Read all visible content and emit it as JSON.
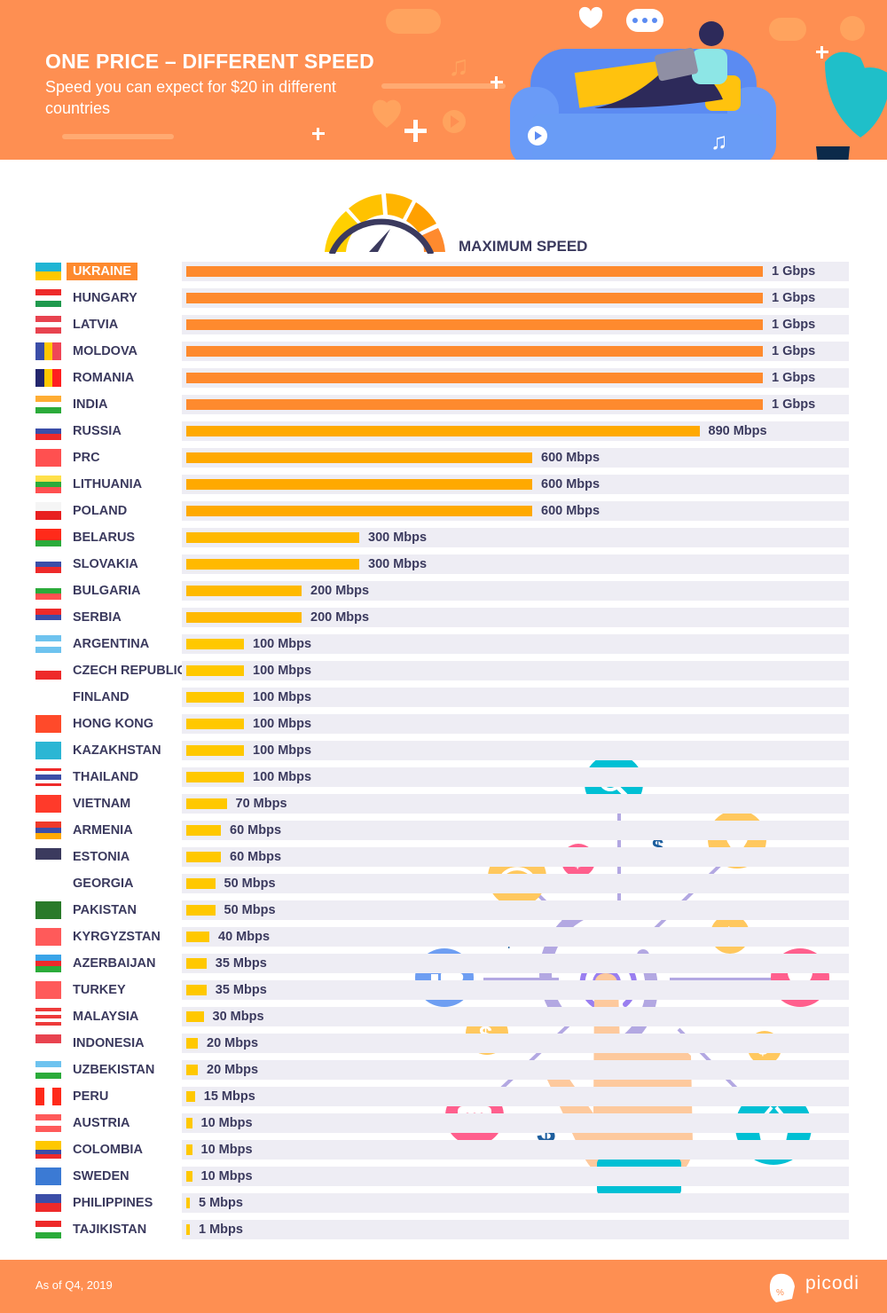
{
  "header": {
    "title": "ONE PRICE – DIFFERENT SPEED",
    "subtitle": "Speed you can expect for $20 in different countries"
  },
  "legend_label": "MAXIMUM SPEED",
  "footer": {
    "note": "As of Q4, 2019",
    "brand": "picodi"
  },
  "colors": {
    "header_bg": "#fe8f52",
    "bar_orange": "#fe8a2e",
    "bar_amber": "#ffa900",
    "bar_gold": "#ffb900",
    "bar_yellow": "#ffc800",
    "text_dark": "#3b3a5e",
    "track": "#eeedf4"
  },
  "chart_data": {
    "type": "bar",
    "orientation": "horizontal",
    "title": "ONE PRICE – DIFFERENT SPEED",
    "subtitle": "Speed you can expect for $20 in different countries",
    "series_label": "MAXIMUM SPEED",
    "unit": "Mbps",
    "highlighted": "UKRAINE",
    "categories": [
      "UKRAINE",
      "HUNGARY",
      "LATVIA",
      "MOLDOVA",
      "ROMANIA",
      "INDIA",
      "RUSSIA",
      "PRC",
      "LITHUANIA",
      "POLAND",
      "BELARUS",
      "SLOVAKIA",
      "BULGARIA",
      "SERBIA",
      "ARGENTINA",
      "CZECH REPUBLIC",
      "FINLAND",
      "HONG KONG",
      "KAZAKHSTAN",
      "THAILAND",
      "VIETNAM",
      "ARMENIA",
      "ESTONIA",
      "GEORGIA",
      "PAKISTAN",
      "KYRGYZSTAN",
      "AZERBAIJAN",
      "TURKEY",
      "MALAYSIA",
      "INDONESIA",
      "UZBEKISTAN",
      "PERU",
      "AUSTRIA",
      "COLOMBIA",
      "SWEDEN",
      "PHILIPPINES",
      "TAJIKISTAN"
    ],
    "values": [
      1000,
      1000,
      1000,
      1000,
      1000,
      1000,
      890,
      600,
      600,
      600,
      300,
      300,
      200,
      200,
      100,
      100,
      100,
      100,
      100,
      100,
      70,
      60,
      60,
      50,
      50,
      40,
      35,
      35,
      30,
      20,
      20,
      15,
      10,
      10,
      10,
      5,
      1
    ],
    "value_labels": [
      "1 Gbps",
      "1 Gbps",
      "1 Gbps",
      "1 Gbps",
      "1 Gbps",
      "1 Gbps",
      "890 Mbps",
      "600 Mbps",
      "600 Mbps",
      "600 Mbps",
      "300 Mbps",
      "300 Mbps",
      "200 Mbps",
      "200 Mbps",
      "100 Mbps",
      "100 Mbps",
      "100 Mbps",
      "100 Mbps",
      "100 Mbps",
      "100 Mbps",
      "70 Mbps",
      "60 Mbps",
      "60 Mbps",
      "50 Mbps",
      "50 Mbps",
      "40 Mbps",
      "35 Mbps",
      "35 Mbps",
      "30 Mbps",
      "20 Mbps",
      "20 Mbps",
      "15 Mbps",
      "10 Mbps",
      "10 Mbps",
      "10 Mbps",
      "5 Mbps",
      "1 Mbps"
    ],
    "xlim": [
      0,
      1000
    ],
    "grid": false,
    "legend": "top-center",
    "xlabel": "",
    "ylabel": ""
  },
  "flags": [
    {
      "type": "h",
      "colors": [
        "#1fb5d4",
        "#ffc800"
      ]
    },
    {
      "type": "h",
      "colors": [
        "#ee2a2a",
        "#ffffff",
        "#1f9a4e"
      ]
    },
    {
      "type": "h3",
      "colors": [
        "#e8434f",
        "#ffffff",
        "#e8434f"
      ]
    },
    {
      "type": "v",
      "colors": [
        "#3b4ea8",
        "#ffc800",
        "#f04656"
      ]
    },
    {
      "type": "v",
      "colors": [
        "#23266d",
        "#ffc800",
        "#ff1f1f"
      ]
    },
    {
      "type": "h",
      "colors": [
        "#ffad33",
        "#ffffff",
        "#2bab3a"
      ]
    },
    {
      "type": "h",
      "colors": [
        "#ffffff",
        "#3b4ea8",
        "#ee2a2a"
      ]
    },
    {
      "type": "h",
      "colors": [
        "#ff5050"
      ]
    },
    {
      "type": "h",
      "colors": [
        "#ffe04a",
        "#2bab3a",
        "#ff5050"
      ]
    },
    {
      "type": "h",
      "colors": [
        "#f5f5f5",
        "#e82020"
      ]
    },
    {
      "type": "h",
      "colors": [
        "#ff2a1a",
        "#ff2a1a",
        "#2bab3a"
      ]
    },
    {
      "type": "h",
      "colors": [
        "#ffffff",
        "#3b4ea8",
        "#ee2a2a"
      ]
    },
    {
      "type": "h",
      "colors": [
        "#ffffff",
        "#2bab3a",
        "#ff5050"
      ]
    },
    {
      "type": "h",
      "colors": [
        "#ee2a2a",
        "#3b4ea8",
        "#ffffff"
      ]
    },
    {
      "type": "h",
      "colors": [
        "#6ec3ef",
        "#ffffff",
        "#6ec3ef"
      ]
    },
    {
      "type": "h",
      "colors": [
        "#ffffff",
        "#ee2a2a"
      ]
    },
    {
      "type": "h",
      "colors": [
        "#ffffff"
      ]
    },
    {
      "type": "h",
      "colors": [
        "#ff4a2a"
      ]
    },
    {
      "type": "h",
      "colors": [
        "#2bb6d4"
      ]
    },
    {
      "type": "h",
      "colors": [
        "#ee2a2a",
        "#ffffff",
        "#3b4ea8",
        "#3b4ea8",
        "#ffffff",
        "#ee2a2a"
      ]
    },
    {
      "type": "h",
      "colors": [
        "#ff3a2a"
      ]
    },
    {
      "type": "h",
      "colors": [
        "#ee3a2a",
        "#3b4ea8",
        "#ffa900"
      ]
    },
    {
      "type": "h",
      "colors": [
        "#3b3a5e",
        "#3b3a5e",
        "#ffffff"
      ]
    },
    {
      "type": "h",
      "colors": [
        "#ffffff"
      ]
    },
    {
      "type": "h",
      "colors": [
        "#2a7a2a"
      ]
    },
    {
      "type": "h",
      "colors": [
        "#ff5a5a"
      ]
    },
    {
      "type": "h",
      "colors": [
        "#3aa4e8",
        "#ee2a2a",
        "#2bab3a"
      ]
    },
    {
      "type": "h",
      "colors": [
        "#ff5a5a"
      ]
    },
    {
      "type": "h",
      "colors": [
        "#ee3a3a",
        "#ffffff",
        "#ee3a3a",
        "#ffffff",
        "#ee3a3a"
      ]
    },
    {
      "type": "h",
      "colors": [
        "#e8434f",
        "#ffffff"
      ]
    },
    {
      "type": "h",
      "colors": [
        "#6ec3ef",
        "#ffffff",
        "#2bab3a"
      ]
    },
    {
      "type": "v",
      "colors": [
        "#ff2a1a",
        "#ffffff",
        "#ff2a1a"
      ]
    },
    {
      "type": "h",
      "colors": [
        "#ff5a5a",
        "#ffffff",
        "#ff5a5a"
      ]
    },
    {
      "type": "h",
      "colors": [
        "#ffc800",
        "#ffc800",
        "#3b4ea8",
        "#ee2a2a"
      ]
    },
    {
      "type": "h",
      "colors": [
        "#3b7ad4"
      ]
    },
    {
      "type": "h",
      "colors": [
        "#3b4ea8",
        "#ee2a2a"
      ]
    },
    {
      "type": "h",
      "colors": [
        "#ee2a2a",
        "#ffffff",
        "#2bab3a"
      ]
    }
  ]
}
